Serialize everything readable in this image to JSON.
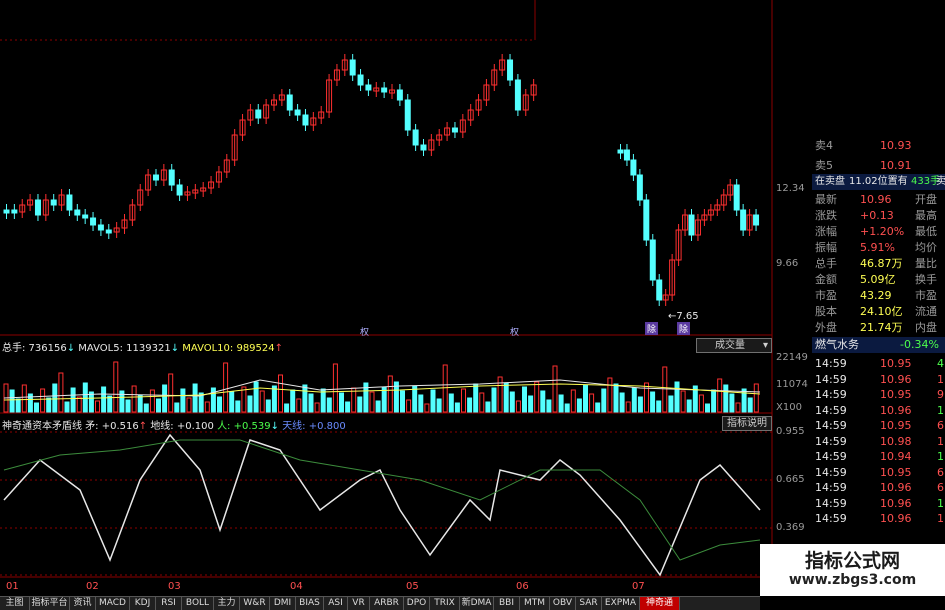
{
  "main_chart": {
    "price_labels": [
      "12.34",
      "9.66"
    ],
    "low_annotation": "←7.65",
    "markers": [
      "除",
      "权",
      "除",
      "权"
    ]
  },
  "volume_panel": {
    "header": {
      "total_label": "总手: 736156",
      "mavol5": "MAVOL5: 1139321",
      "mavol10": "MAVOL10: 989524"
    },
    "selector": "成交量",
    "axis_labels": [
      "22149",
      "11074",
      "X100"
    ]
  },
  "indicator_panel": {
    "name": "神奇通资本矛盾线",
    "label_x": "矛: +0.516",
    "label_ground": "地线: +0.100",
    "label_ren": "人: +0.539",
    "label_sky": "天线: +0.800",
    "help_button": "指标说明",
    "axis_labels": [
      "0.955",
      "0.665",
      "0.369"
    ]
  },
  "x_axis_labels": [
    "01",
    "02",
    "03",
    "04",
    "05",
    "06",
    "07"
  ],
  "quote": {
    "asks": [
      {
        "level": "卖4",
        "price": "10.93"
      },
      {
        "level": "卖5",
        "price": "10.91"
      }
    ],
    "order_bar": {
      "left": "在卖盘",
      "middle": "11.02位置有",
      "right": "433手",
      "tail": "卖"
    },
    "fields": [
      {
        "k1": "最新",
        "v1": "10.96",
        "k2": "开盘"
      },
      {
        "k1": "涨跌",
        "v1": "+0.13",
        "k2": "最高"
      },
      {
        "k1": "涨幅",
        "v1": "+1.20%",
        "k2": "最低"
      },
      {
        "k1": "振幅",
        "v1": "5.91%",
        "k2": "均价"
      },
      {
        "k1": "总手",
        "v1": "46.87万",
        "k2": "量比"
      },
      {
        "k1": "金额",
        "v1": "5.09亿",
        "k2": "换手"
      },
      {
        "k1": "市盈",
        "v1": "43.29",
        "k2": "市盈"
      },
      {
        "k1": "股本",
        "v1": "24.10亿",
        "k2": "流通"
      },
      {
        "k1": "外盘",
        "v1": "21.74万",
        "k2": "内盘"
      }
    ],
    "sector": {
      "name": "燃气水务",
      "change": "-0.34%"
    },
    "ticks": [
      {
        "time": "14:59",
        "price": "10.95"
      },
      {
        "time": "14:59",
        "price": "10.96"
      },
      {
        "time": "14:59",
        "price": "10.95"
      },
      {
        "time": "14:59",
        "price": "10.96"
      },
      {
        "time": "14:59",
        "price": "10.95"
      },
      {
        "time": "14:59",
        "price": "10.98"
      },
      {
        "time": "14:59",
        "price": "10.94"
      },
      {
        "time": "14:59",
        "price": "10.95"
      },
      {
        "time": "14:59",
        "price": "10.96"
      },
      {
        "time": "14:59",
        "price": "10.96"
      },
      {
        "time": "14:59",
        "price": "10.96"
      }
    ],
    "tick_vols": [
      "4",
      "1",
      "9",
      "1",
      "6",
      "1",
      "1",
      "6",
      "6",
      "1",
      "1"
    ]
  },
  "tabs": [
    "主图",
    "指标平台",
    "资讯",
    "MACD",
    "KDJ",
    "RSI",
    "BOLL",
    "主力",
    "W&R",
    "DMI",
    "BIAS",
    "ASI",
    "VR",
    "ARBR",
    "DPO",
    "TRIX",
    "新DMA",
    "BBI",
    "MTM",
    "OBV",
    "SAR",
    "EXPMA",
    "神奇通"
  ],
  "watermark": {
    "title": "指标公式网",
    "url": "www.zbgs3.com"
  },
  "colors": {
    "up": "#ff3030",
    "down": "#54ffff",
    "panel_bg": "#000000",
    "grid": "#8b0000"
  }
}
